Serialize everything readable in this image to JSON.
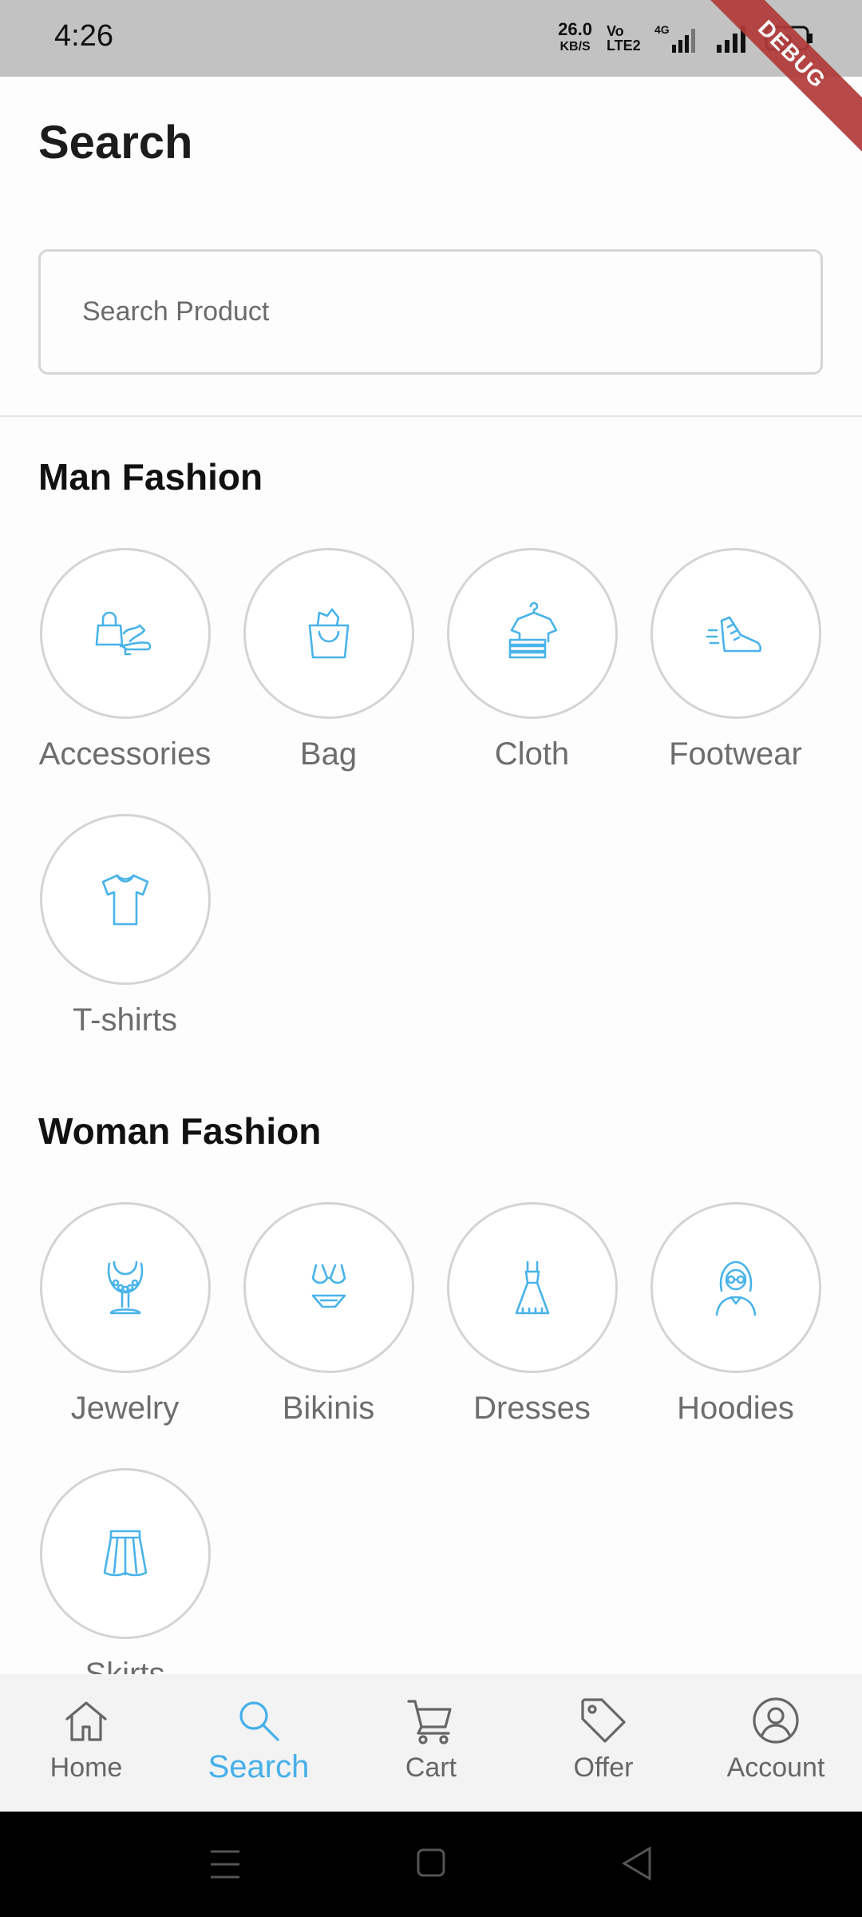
{
  "status_bar": {
    "time": "4:26",
    "net_speed_value": "26.0",
    "net_speed_unit": "KB/S",
    "volte": "Vo LTE2",
    "network": "4G",
    "battery": "70",
    "debug_label": "DEBUG"
  },
  "header": {
    "title": "Search"
  },
  "search": {
    "placeholder": "Search Product"
  },
  "sections": {
    "man": {
      "title": "Man Fashion",
      "items": [
        {
          "label": "Accessories",
          "icon": "accessories-icon"
        },
        {
          "label": "Bag",
          "icon": "shopping-bag-icon"
        },
        {
          "label": "Cloth",
          "icon": "cloth-icon"
        },
        {
          "label": "Footwear",
          "icon": "shoe-icon"
        },
        {
          "label": "T-shirts",
          "icon": "tshirt-icon"
        }
      ]
    },
    "woman": {
      "title": "Woman Fashion",
      "items": [
        {
          "label": "Jewelry",
          "icon": "necklace-icon"
        },
        {
          "label": "Bikinis",
          "icon": "bikini-icon"
        },
        {
          "label": "Dresses",
          "icon": "dress-icon"
        },
        {
          "label": "Hoodies",
          "icon": "woman-avatar-icon"
        },
        {
          "label": "Skirts",
          "icon": "skirt-icon"
        }
      ]
    }
  },
  "bottom_nav": {
    "items": [
      {
        "label": "Home",
        "icon": "home-icon"
      },
      {
        "label": "Search",
        "icon": "search-icon",
        "active": true
      },
      {
        "label": "Cart",
        "icon": "cart-icon"
      },
      {
        "label": "Offer",
        "icon": "tag-icon"
      },
      {
        "label": "Account",
        "icon": "account-icon"
      }
    ]
  },
  "colors": {
    "accent": "#45b0ea",
    "icon": "#49b3ea",
    "status_bar": "#c2c2c2",
    "debug_ribbon": "#b23a3a"
  }
}
